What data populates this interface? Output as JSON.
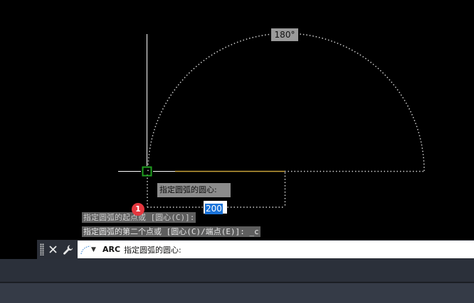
{
  "viewport": {
    "angle_tooltip": "180°",
    "dynamic_input": {
      "prompt": "指定圆弧的圆心:",
      "value": "200"
    },
    "notification_badge": "1"
  },
  "command_history": [
    "指定圆弧的起点或 [圆心(C)]:",
    "指定圆弧的第二个点或 [圆心(C)/端点(E)]: _c"
  ],
  "command_line": {
    "command_name": "ARC",
    "prompt": "指定圆弧的圆心:",
    "icons": {
      "grip": "grip-icon",
      "close": "close-icon",
      "customize": "wrench-icon",
      "recent_commands": "arc-icon"
    }
  },
  "colors": {
    "background": "#000000",
    "crosshair": "#ffffff",
    "osnap_marker": "#1fa01f",
    "input_highlight": "#1a73d9",
    "badge": "#e5373f",
    "bar": "#2b2f38"
  }
}
